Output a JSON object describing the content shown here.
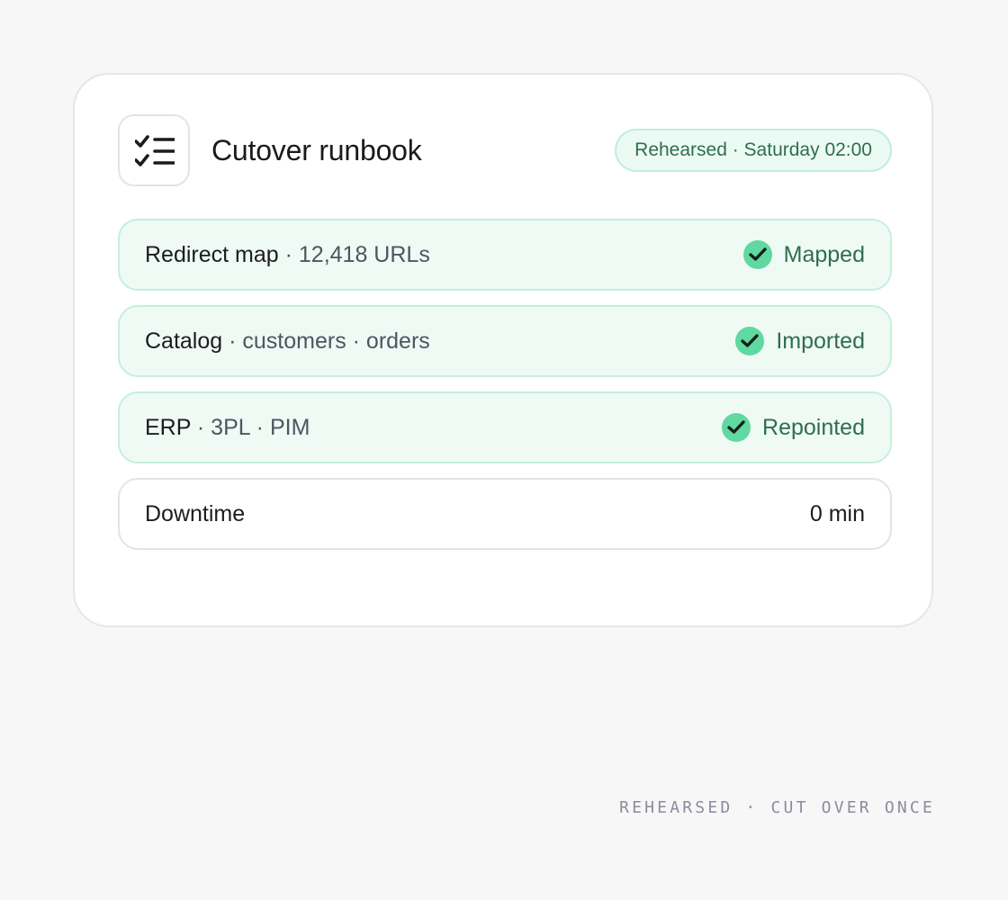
{
  "card": {
    "title": "Cutover runbook",
    "icon": "checklist-icon",
    "status_pill": "Rehearsed · Saturday 02:00"
  },
  "rows": [
    {
      "label": "Redirect map",
      "separator": " · ",
      "detail": "12,418 URLs",
      "status": "Mapped",
      "icon": "check-circle-icon"
    },
    {
      "label": "Catalog",
      "separator": " · ",
      "detail": "customers · orders",
      "status": "Imported",
      "icon": "check-circle-icon"
    },
    {
      "label": "ERP",
      "separator": " · ",
      "detail": "3PL · PIM",
      "status": "Repointed",
      "icon": "check-circle-icon"
    },
    {
      "label": "Downtime",
      "value": "0 min"
    }
  ],
  "footer": "REHEARSED · CUT OVER ONCE",
  "colors": {
    "background": "#f7f7f8",
    "card": "#ffffff",
    "success_fill": "#effaf5",
    "success_border": "#c5efdd",
    "check": "#5fd9a0",
    "success_text": "#2f6e51",
    "footer_text": "#8a8d9b"
  }
}
